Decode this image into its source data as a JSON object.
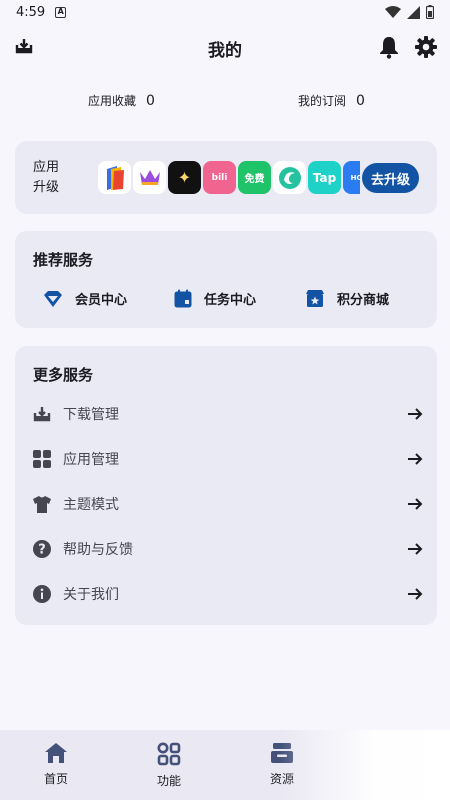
{
  "status_bar": {
    "time": "4:59",
    "a_icon": "A"
  },
  "header": {
    "title": "我的"
  },
  "stats": [
    {
      "label": "应用收藏",
      "value": "0"
    },
    {
      "label": "我的订阅",
      "value": "0"
    }
  ],
  "upgrade": {
    "label": "应用升级",
    "button": "去升级",
    "apps": [
      {
        "name": "app-book",
        "color": "#ffffff",
        "text": ""
      },
      {
        "name": "app-crown",
        "color": "#ffffff",
        "text": ""
      },
      {
        "name": "app-sparkle",
        "color": "#111111",
        "text": "✦"
      },
      {
        "name": "app-bilibili",
        "color": "#f0648f",
        "text": "bili"
      },
      {
        "name": "app-free",
        "color": "#1fc36a",
        "text": "免费"
      },
      {
        "name": "app-spiral",
        "color": "#ffffff",
        "text": ""
      },
      {
        "name": "app-tap",
        "color": "#1ed2c8",
        "text": "Tap"
      },
      {
        "name": "app-hon",
        "color": "#2b7cf0",
        "text": "HON"
      }
    ]
  },
  "recommend": {
    "title": "推荐服务",
    "items": [
      {
        "label": "会员中心",
        "icon": "diamond-icon"
      },
      {
        "label": "任务中心",
        "icon": "calendar-icon"
      },
      {
        "label": "积分商城",
        "icon": "shop-icon"
      }
    ]
  },
  "more": {
    "title": "更多服务",
    "items": [
      {
        "label": "下载管理",
        "icon": "download-tray-icon"
      },
      {
        "label": "应用管理",
        "icon": "grid-apps-icon"
      },
      {
        "label": "主题模式",
        "icon": "tshirt-icon"
      },
      {
        "label": "帮助与反馈",
        "icon": "help-icon"
      },
      {
        "label": "关于我们",
        "icon": "info-icon"
      }
    ]
  },
  "nav": [
    {
      "label": "首页",
      "icon": "home-icon"
    },
    {
      "label": "功能",
      "icon": "function-grid-icon"
    },
    {
      "label": "资源",
      "icon": "resource-box-icon"
    }
  ],
  "colors": {
    "accent": "#1253a3",
    "card": "#eaeaf5",
    "background": "#f7f6fc"
  }
}
